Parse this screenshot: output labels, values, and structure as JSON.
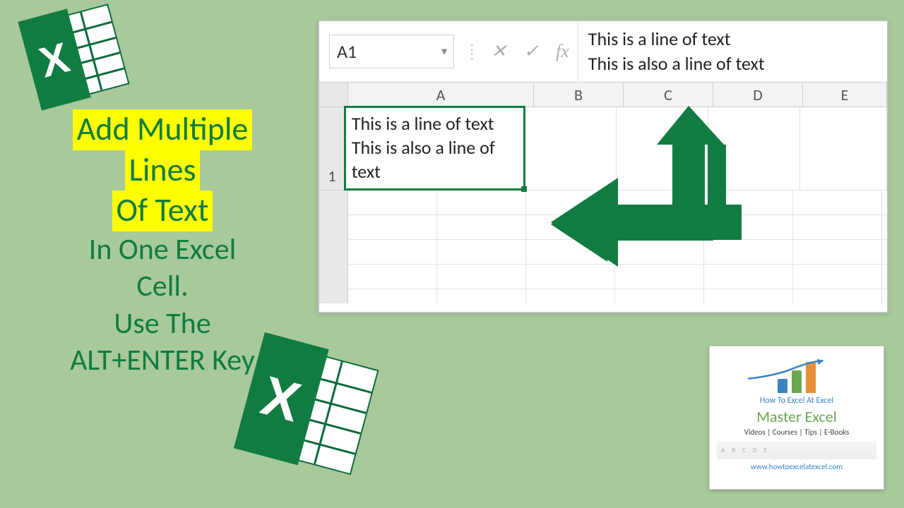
{
  "title": {
    "line1": "Add Multiple",
    "line2": "Lines",
    "line3": "Of Text",
    "line4": "In One Excel",
    "line5": "Cell.",
    "line6": "Use The",
    "line7": "ALT+ENTER Key"
  },
  "excel": {
    "name_box": "A1",
    "fx_label": "fx",
    "formula_line1": "This is a line of text",
    "formula_line2": "This is also a line of text",
    "columns": [
      "A",
      "B",
      "C",
      "D",
      "E"
    ],
    "row1_label": "1",
    "cell_a1_line1": "This is a line of text",
    "cell_a1_line2": "This is also a line of",
    "cell_a1_line3": "text"
  },
  "promo": {
    "tagline": "How To Excel At Excel",
    "headline": "Master Excel",
    "sub": "Videos | Courses | Tips | E-Books",
    "url": "www.howtoexcelatexcel.com"
  },
  "icons": {
    "excel_letter": "X"
  }
}
